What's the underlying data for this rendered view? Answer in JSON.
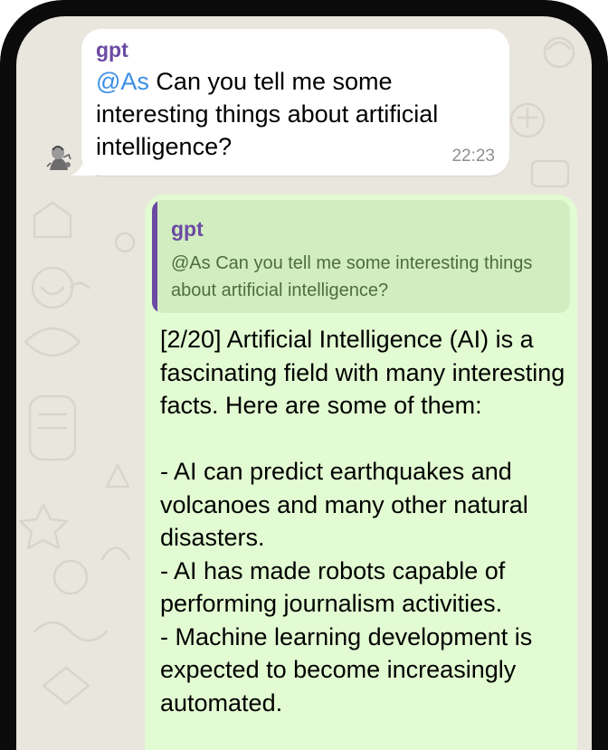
{
  "incoming_message": {
    "sender": "gpt",
    "mention": "@As",
    "text": " Can you tell me some interesting things about artificial intelligence?",
    "time": "22:23"
  },
  "outgoing_message": {
    "reply_sender": "gpt",
    "reply_text": "@As Can you tell me some interesting things about artificial intelligence?",
    "text": "[2/20] Artificial Intelligence (AI) is a fascinating field with many interesting facts. Here are some of them:\n\n- AI can predict earthquakes and volcanoes and many other natural disasters.\n- AI has made robots capable of performing journalism activities.\n- Machine learning development is expected to become increasingly automated."
  },
  "colors": {
    "frame": "#0b0b0b",
    "wallpaper": "#e9e6de",
    "incoming_bubble": "#ffffff",
    "outgoing_bubble": "#e2fbd2",
    "reply_background": "#d2eec1",
    "sender_name": "#6b4aa3",
    "mention": "#3a8ee6"
  },
  "icons": {
    "avatar": "avatar-image"
  }
}
